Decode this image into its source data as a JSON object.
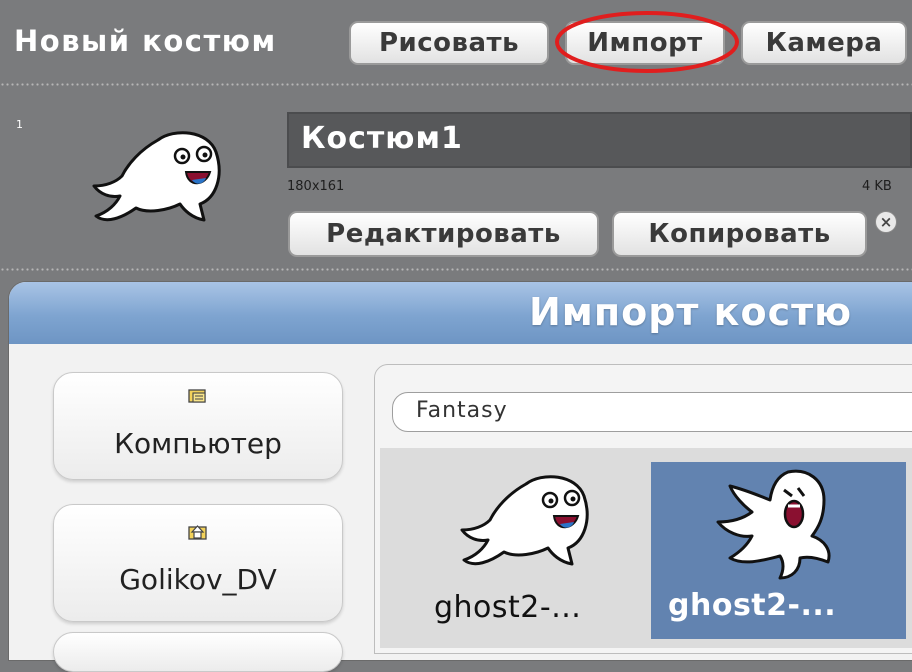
{
  "toolbar": {
    "title": "Новый костюм",
    "paint_label": "Рисовать",
    "import_label": "Импорт",
    "camera_label": "Камера",
    "highlight_color": "#e01e1e"
  },
  "costume": {
    "index": "1",
    "name": "Костюм1",
    "dimensions": "180x161",
    "size": "4 KB",
    "edit_label": "Редактировать",
    "copy_label": "Копировать",
    "delete_icon": "close-icon",
    "delete_glyph": "×"
  },
  "import_dialog": {
    "title": "Импорт костю",
    "sidebar": [
      {
        "label": "Компьютер",
        "icon": "computer-folder-icon"
      },
      {
        "label": "Golikov_DV",
        "icon": "home-folder-icon"
      }
    ],
    "folder": "Fantasy",
    "items": [
      {
        "label": "ghost2-...",
        "selected": false,
        "icon": "ghost-icon"
      },
      {
        "label": "ghost2-...",
        "selected": true,
        "icon": "ghost-screaming-icon"
      }
    ],
    "selection_color": "#6283b0"
  }
}
